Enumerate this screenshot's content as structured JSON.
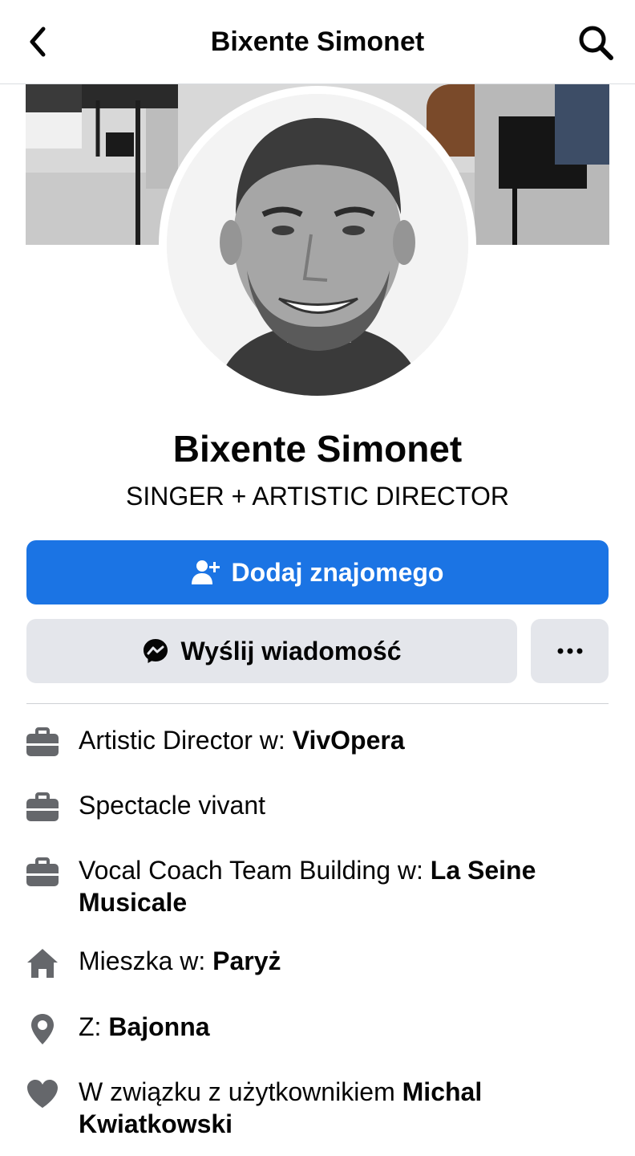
{
  "header": {
    "title": "Bixente Simonet",
    "back_icon": "chevron-left-icon",
    "search_icon": "search-icon"
  },
  "profile": {
    "name": "Bixente Simonet",
    "bio": "SINGER + ARTISTIC DIRECTOR"
  },
  "actions": {
    "add_friend_label": "Dodaj znajomego",
    "message_label": "Wyślij wiadomość",
    "more_icon": "more-dots-icon"
  },
  "details": [
    {
      "icon": "briefcase-icon",
      "prefix": "Artistic Director w: ",
      "bold": "VivOpera"
    },
    {
      "icon": "briefcase-icon",
      "prefix": "Spectacle vivant",
      "bold": ""
    },
    {
      "icon": "briefcase-icon",
      "prefix": "Vocal Coach Team Building w: ",
      "bold": "La Seine Musicale"
    },
    {
      "icon": "home-icon",
      "prefix": "Mieszka w: ",
      "bold": "Paryż"
    },
    {
      "icon": "location-pin-icon",
      "prefix": "Z: ",
      "bold": "Bajonna"
    },
    {
      "icon": "heart-icon",
      "prefix": "W związku z użytkownikiem ",
      "bold": "Michal Kwiatkowski"
    }
  ],
  "colors": {
    "primary": "#1b74e4",
    "secondary_bg": "#e4e6eb",
    "icon_gray": "#65676b"
  }
}
